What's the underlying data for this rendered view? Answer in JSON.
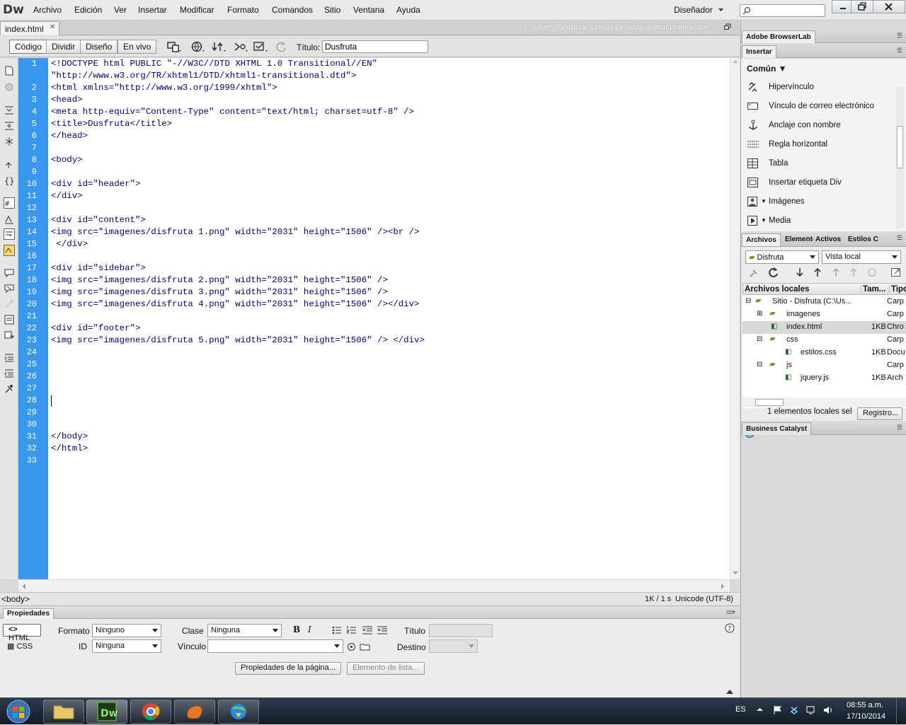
{
  "app": {
    "logo": "Dw",
    "workspace": "Diseñador"
  },
  "menu": [
    "Archivo",
    "Edición",
    "Ver",
    "Insertar",
    "Modificar",
    "Formato",
    "Comandos",
    "Sitio",
    "Ventana",
    "Ayuda"
  ],
  "document": {
    "tab": "index.html",
    "path": "C:\\Users\\Córdova Salinas\\Desktop\\disfruta\\index.html"
  },
  "toolbar": {
    "views": [
      "Código",
      "Dividir",
      "Diseño",
      "En vivo"
    ],
    "title_label": "Título:",
    "title_value": "Dusfruta"
  },
  "code": {
    "line_numbers": [
      "1",
      "2",
      "3",
      "4",
      "5",
      "6",
      "7",
      "8",
      "9",
      "10",
      "11",
      "12",
      "13",
      "14",
      "15",
      "16",
      "17",
      "18",
      "19",
      "20",
      "21",
      "22",
      "23",
      "24",
      "25",
      "26",
      "27",
      "28",
      "29",
      "30",
      "31",
      "32",
      "33"
    ],
    "lines": [
      "<!DOCTYPE html PUBLIC \"-//W3C//DTD XHTML 1.0 Transitional//EN\"",
      "\"http://www.w3.org/TR/xhtml1/DTD/xhtml1-transitional.dtd\">",
      "<html xmlns=\"http://www.w3.org/1999/xhtml\">",
      "<head>",
      "<meta http-equiv=\"Content-Type\" content=\"text/html; charset=utf-8\" />",
      "<title>Dusfruta</title>",
      "</head>",
      "",
      "<body>",
      "",
      "<div id=\"header\">",
      "</div>",
      "",
      "<div id=\"content\">",
      "<img src=\"imagenes/disfruta 1.png\" width=\"2031\" height=\"1506\" /><br />",
      " </div>",
      "",
      "<div id=\"sidebar\">",
      "<img src=\"imagenes/disfruta 2.png\" width=\"2031\" height=\"1506\" />",
      "<img src=\"imagenes/disfruta 3.png\" width=\"2031\" height=\"1506\" />",
      "<img src=\"imagenes/disfruta 4.png\" width=\"2031\" height=\"1506\" /></div>",
      "",
      "<div id=\"footer\">",
      "<img src=\"imagenes/disfruta 5.png\" width=\"2031\" height=\"1506\" /> </div>",
      "",
      "",
      "",
      "",
      "",
      "",
      "</body>",
      "</html>",
      ""
    ]
  },
  "status": {
    "tag": "<body>",
    "size": "1K / 1 s",
    "encoding": "Unicode (UTF-8)"
  },
  "properties": {
    "panel_title": "Propiedades",
    "html_btn": "HTML",
    "css_btn": "CSS",
    "formato_label": "Formato",
    "formato_value": "Ninguno",
    "clase_label": "Clase",
    "clase_value": "Ninguna",
    "id_label": "ID",
    "id_value": "Ninguna",
    "vinculo_label": "Vínculo",
    "titulo_label": "Título",
    "destino_label": "Destino",
    "page_props_btn": "Propiedades de la página...",
    "list_item_btn": "Elemento de lista..."
  },
  "panels": {
    "browserlab": "Adobe BrowserLab",
    "insert": "Insertar",
    "insert_category": "Común",
    "insert_items": [
      "Hipervínculo",
      "Vínculo de correo electrónico",
      "Anclaje con nombre",
      "Regla horizontal",
      "Tabla",
      "Insertar etiqueta Div",
      "Imágenes",
      "Media"
    ],
    "files_tabs": [
      "Archivos",
      "Elemento",
      "Activos",
      "Estilos CS"
    ],
    "site_select": "Disfruta",
    "view_select": "Vista local",
    "columns": [
      "Archivos locales",
      "Tam...",
      "Tipo"
    ],
    "tree": [
      {
        "name": "Sitio - Disfruta (C:\\Us...",
        "size": "",
        "type": "Carp"
      },
      {
        "name": "imagenes",
        "size": "",
        "type": "Carp"
      },
      {
        "name": "index.html",
        "size": "1KB",
        "type": "Chro"
      },
      {
        "name": "css",
        "size": "",
        "type": "Carp"
      },
      {
        "name": "estilos.css",
        "size": "1KB",
        "type": "Docu"
      },
      {
        "name": "js",
        "size": "",
        "type": "Carp"
      },
      {
        "name": "jquery.js",
        "size": "1KB",
        "type": "Arch"
      }
    ],
    "files_status": "1 elementos locales sel",
    "log_btn": "Registro...",
    "business": "Business Catalyst"
  },
  "taskbar": {
    "lang": "ES",
    "time": "08:55 a.m.",
    "date": "17/10/2014"
  }
}
